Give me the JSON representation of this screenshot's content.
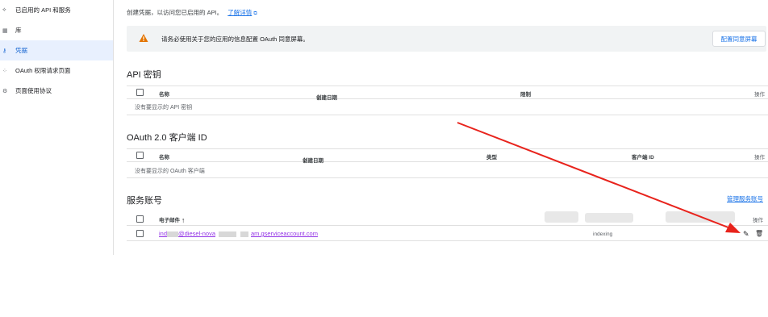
{
  "sidebar": {
    "items": [
      {
        "icon": "api-icon",
        "glyph": "⟡",
        "label": "已启用的 API 和服务"
      },
      {
        "icon": "library-icon",
        "glyph": "▦",
        "label": "库"
      },
      {
        "icon": "key-icon",
        "glyph": "⚷",
        "label": "凭据"
      },
      {
        "icon": "consent-icon",
        "glyph": "⁘",
        "label": "OAuth 权限请求页面"
      },
      {
        "icon": "settings-icon",
        "glyph": "⚙",
        "label": "页面使用协议"
      }
    ],
    "active_index": 2
  },
  "intro": {
    "text": "创建凭据，以访问您已启用的 API。",
    "link": "了解详情",
    "link_icon": "⧉"
  },
  "banner": {
    "message": "请务必使用关于您的应用的信息配置 OAuth 同意屏幕。",
    "button": "配置同意屏幕",
    "warning_color": "#e37400"
  },
  "api_keys": {
    "title": "API 密钥",
    "columns": [
      "名称",
      "创建日期",
      "限制",
      "操作"
    ],
    "sort_arrow": "↓",
    "empty": "没有要显示的 API 密钥"
  },
  "oauth": {
    "title": "OAuth 2.0 客户端 ID",
    "columns": [
      "名称",
      "创建日期",
      "类型",
      "客户端 ID",
      "操作"
    ],
    "sort_arrow": "↓",
    "empty": "没有要显示的 OAuth 客户端"
  },
  "service_accounts": {
    "title": "服务账号",
    "manage_link": "管理服务账号",
    "columns": [
      "电子邮件",
      "操作"
    ],
    "sort_arrow": "↑",
    "row": {
      "email_part1": "ind",
      "email_part2": "@diesel-nova",
      "email_part3": "am.gserviceaccount.com",
      "status": "indexing",
      "edit_icon": "✎",
      "delete_icon": "🗑"
    }
  },
  "annotation": {
    "arrow_color": "#e8231c"
  }
}
